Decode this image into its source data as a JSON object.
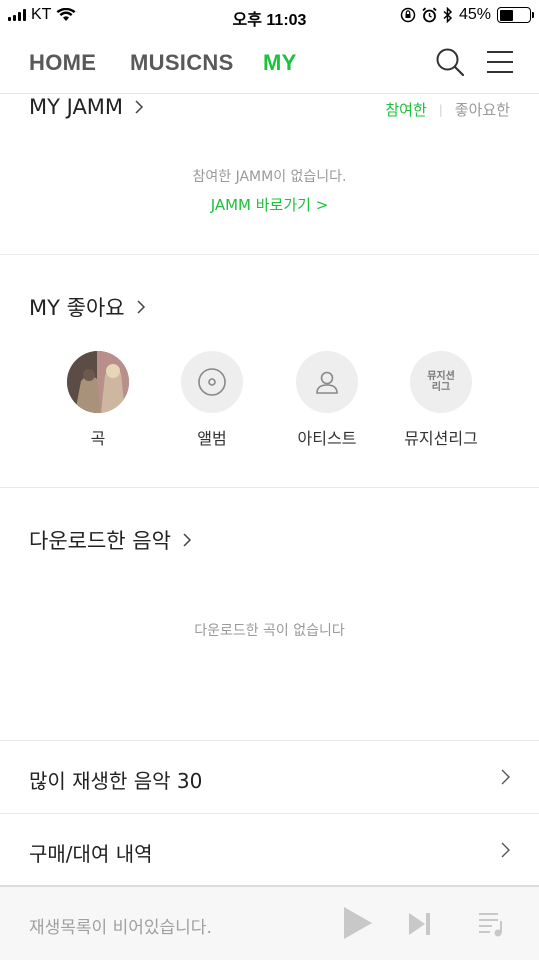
{
  "status": {
    "carrier": "KT",
    "time": "오후 11:03",
    "battery_percent": "45%",
    "battery_level": 0.45
  },
  "nav": {
    "tabs": [
      "HOME",
      "MUSICNS",
      "MY"
    ],
    "active_tab": "MY",
    "accent_color": "#1ec13c"
  },
  "jamm": {
    "title": "MY JAMM",
    "tab_joined": "참여한",
    "tab_liked": "좋아요한",
    "empty_message": "참여한 JAMM이 없습니다.",
    "link": "JAMM 바로가기 >"
  },
  "likes": {
    "title": "MY 좋아요",
    "items": [
      {
        "label": "곡",
        "icon": "song-thumbnail"
      },
      {
        "label": "앨범",
        "icon": "album-disc-icon"
      },
      {
        "label": "아티스트",
        "icon": "artist-person-icon"
      },
      {
        "label": "뮤지션리그",
        "icon": "musician-league-icon",
        "icon_text": "뮤지션\n리그"
      }
    ]
  },
  "downloads": {
    "title": "다운로드한 음악",
    "empty_message": "다운로드한 곡이 없습니다"
  },
  "list": {
    "most_played": "많이 재생한 음악 30",
    "purchases": "구매/대여 내역"
  },
  "player": {
    "message": "재생목록이 비어있습니다."
  }
}
